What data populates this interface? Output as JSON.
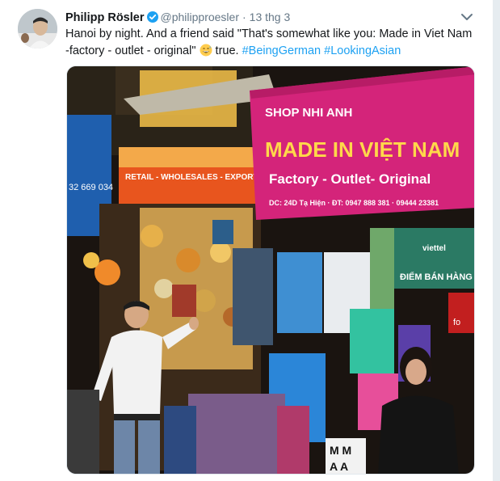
{
  "tweet": {
    "author_name": "Philipp Rösler",
    "author_handle": "@philipproesler",
    "separator": "·",
    "timestamp": "13 thg 3",
    "text_line1": "Hanoi by night. And a friend said \"That's somewhat like you: Made in Viet Nam",
    "text_line2_prefix": "-factory - outlet - original\"",
    "text_line2_after_emoji": "true.",
    "hashtag1": "#BeingGerman",
    "hashtag2": "#LookingAsian",
    "emoji_icon": "grinning-sweat-emoji",
    "verified_color": "#1da1f2"
  },
  "photo_signs": {
    "shop_name": "SHOP NHI ANH",
    "headline": "MADE IN VIỆT NAM",
    "subline": "Factory - Outlet- Original",
    "address": "DC: 24D Tạ Hiện · ĐT: 0947 888 381 · 09444 23381",
    "left_sign": "RETAIL - WHOLESALES - EXPORT",
    "left_phone": "32 669 034",
    "viettel_brand": "viettel",
    "viettel_sign": "ĐIỂM BÁN HÀNG",
    "stand_letters": "M M",
    "stand_letters2": "A A",
    "side_sign": "fo"
  }
}
